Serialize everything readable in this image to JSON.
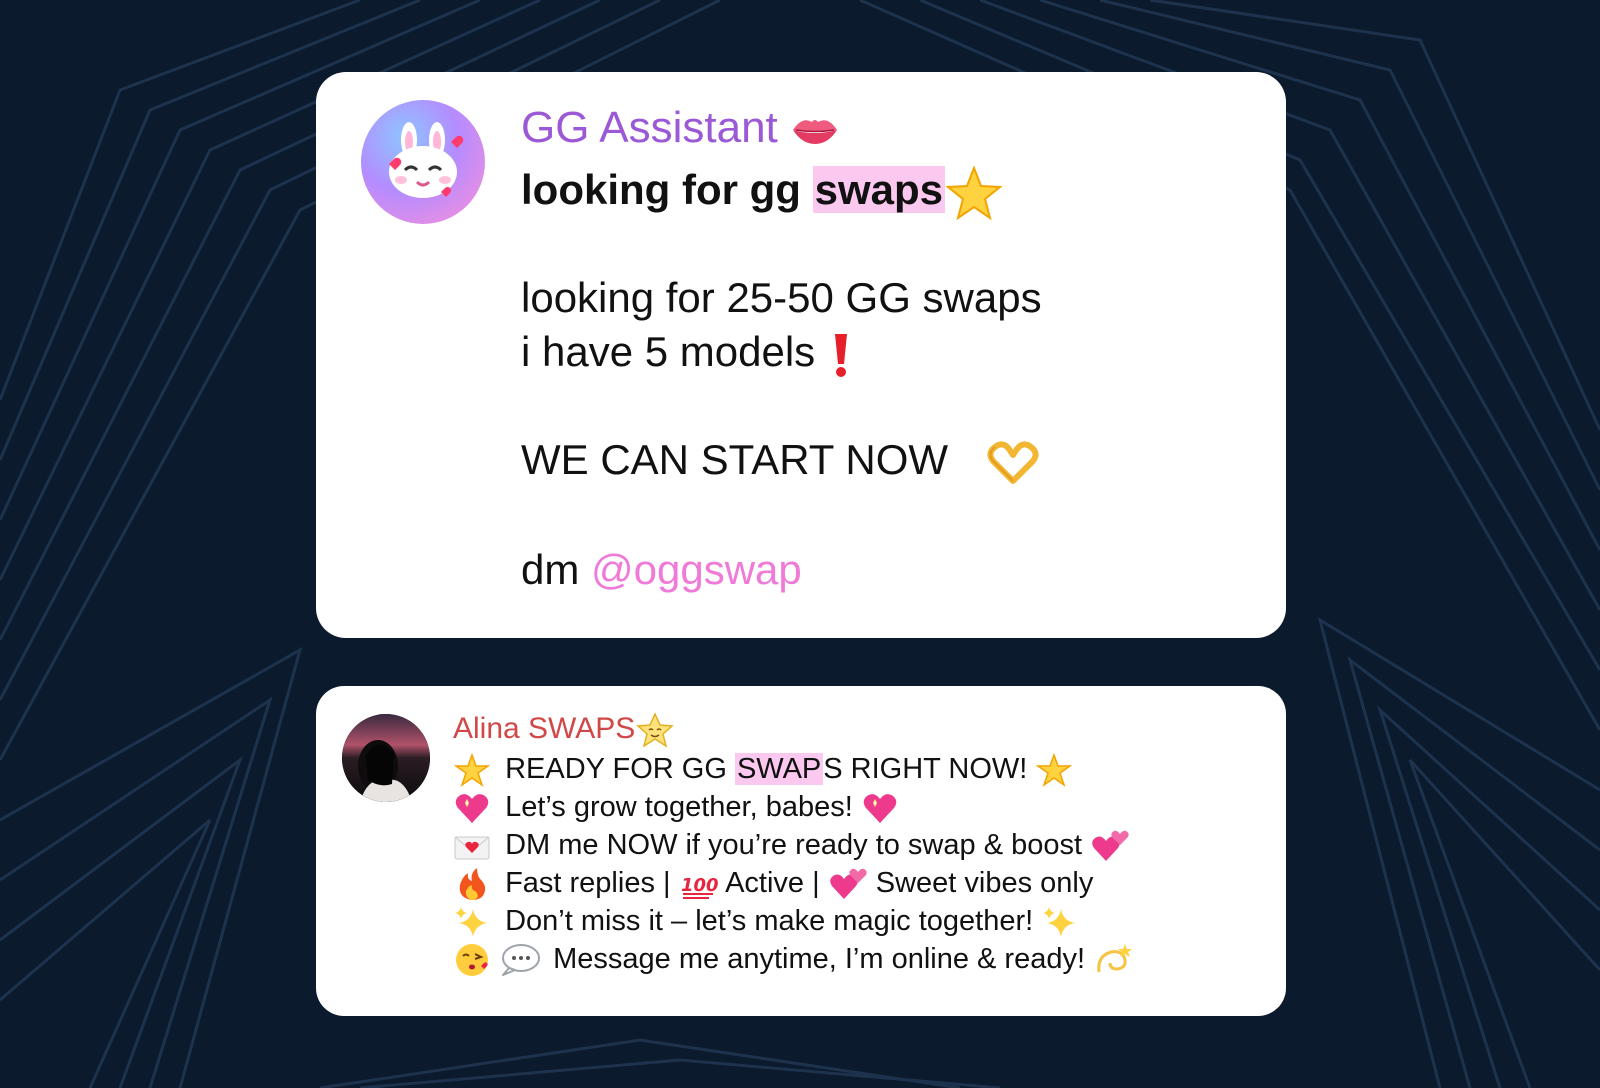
{
  "card1": {
    "sender": "GG Assistant",
    "title_before": "looking for gg ",
    "title_highlight": "swaps",
    "line1": "looking for 25-50 GG swaps",
    "line2": "i have 5 models",
    "line3": "WE CAN START NOW",
    "line4_prefix": "dm ",
    "mention": "@oggswap"
  },
  "card2": {
    "sender": "Alina SWAPS",
    "l1_before": "READY FOR GG ",
    "l1_highlight": "SWAP",
    "l1_after": "S RIGHT NOW!",
    "l2": "Let’s grow together, babes!",
    "l3": "DM me NOW if you’re ready to swap & boost",
    "l4_a": "Fast replies |",
    "l4_b": "Active |",
    "l4_c": "Sweet vibes only",
    "l5": "Don’t miss it – let’s make magic together!",
    "l6": "Message me anytime, I’m online & ready!"
  },
  "icons": {
    "card1_sender": "kiss-lips-icon",
    "card1_title": "star-icon",
    "card1_line2": "red-exclamation-icon",
    "card1_line3": "heart-hands-icon",
    "card2_sender": "star-face-icon",
    "card2_bullets": [
      "glowing-star-icon",
      "sparkling-heart-icon",
      "love-letter-icon",
      "fire-icon",
      "sparkles-icon",
      "kissing-face-icon"
    ]
  },
  "colors": {
    "background": "#0b1a2c",
    "card": "#ffffff",
    "sender1": "#9b59d6",
    "sender2": "#d14848",
    "highlight": "#fbc8f0",
    "mention": "#f07ad8"
  }
}
